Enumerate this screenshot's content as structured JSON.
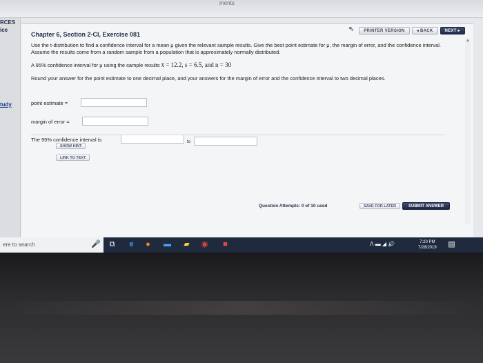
{
  "browser_top": {
    "partial_text": "ments"
  },
  "sidebar": {
    "items": [
      "RCES",
      "ice"
    ],
    "link": "tudy"
  },
  "nav": {
    "printer_version": "PRINTER VERSION",
    "back": "◂ BACK",
    "next": "NEXT ▸"
  },
  "exercise": {
    "title": "Chapter 6, Section 2-CI, Exercise 081",
    "instructions": "Use the t-distribution to find a confidence interval for a mean μ given the relevant sample results. Give the best point estimate for μ, the margin of error, and the confidence interval. Assume the results come from a random sample from a population that is approximately normally distributed.",
    "given_prefix": "A 95% confidence interval for μ using the sample results",
    "given_values": "x̄ = 12.2, s = 6.5, and n = 30",
    "round_note": "Round your answer for the point estimate to one decimal place, and your answers for the margin of error and the confidence interval to two decimal places."
  },
  "fields": {
    "point_estimate_label": "point estimate =",
    "point_estimate_value": "",
    "margin_error_label": "margin of error =",
    "margin_error_value": "",
    "interval_label": "The 95% confidence interval is",
    "interval_low_value": "",
    "interval_to": "to",
    "interval_high_value": ""
  },
  "help": {
    "show_hint": "SHOW HINT",
    "link_to_text": "LINK TO TEXT"
  },
  "footer": {
    "attempts": "Question Attempts: 0 of 10 used",
    "save_later": "SAVE FOR LATER",
    "submit": "SUBMIT ANSWER"
  },
  "taskbar": {
    "search_placeholder": "ere to search",
    "time": "7:20 PM",
    "date": "7/28/2019"
  }
}
